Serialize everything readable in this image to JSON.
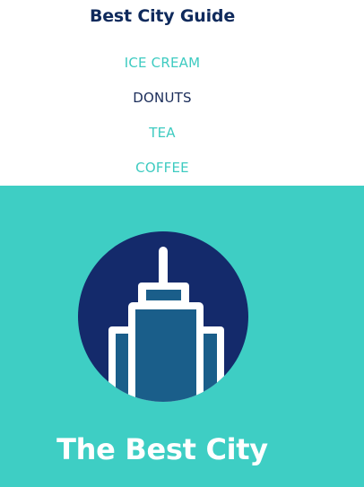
{
  "header": {
    "title": "Best City Guide"
  },
  "nav": {
    "items": [
      {
        "label": "ICE CREAM",
        "active": false
      },
      {
        "label": "DONUTS",
        "active": true
      },
      {
        "label": "TEA",
        "active": false
      },
      {
        "label": "COFFEE",
        "active": false
      }
    ]
  },
  "hero": {
    "title": "The Best City",
    "logo_icon": "skyscraper-icon"
  },
  "colors": {
    "brand_navy": "#0f2a5c",
    "accent_teal": "#3ecec4",
    "circle_navy": "#142a6b",
    "building_blue": "#1a5e8a"
  }
}
